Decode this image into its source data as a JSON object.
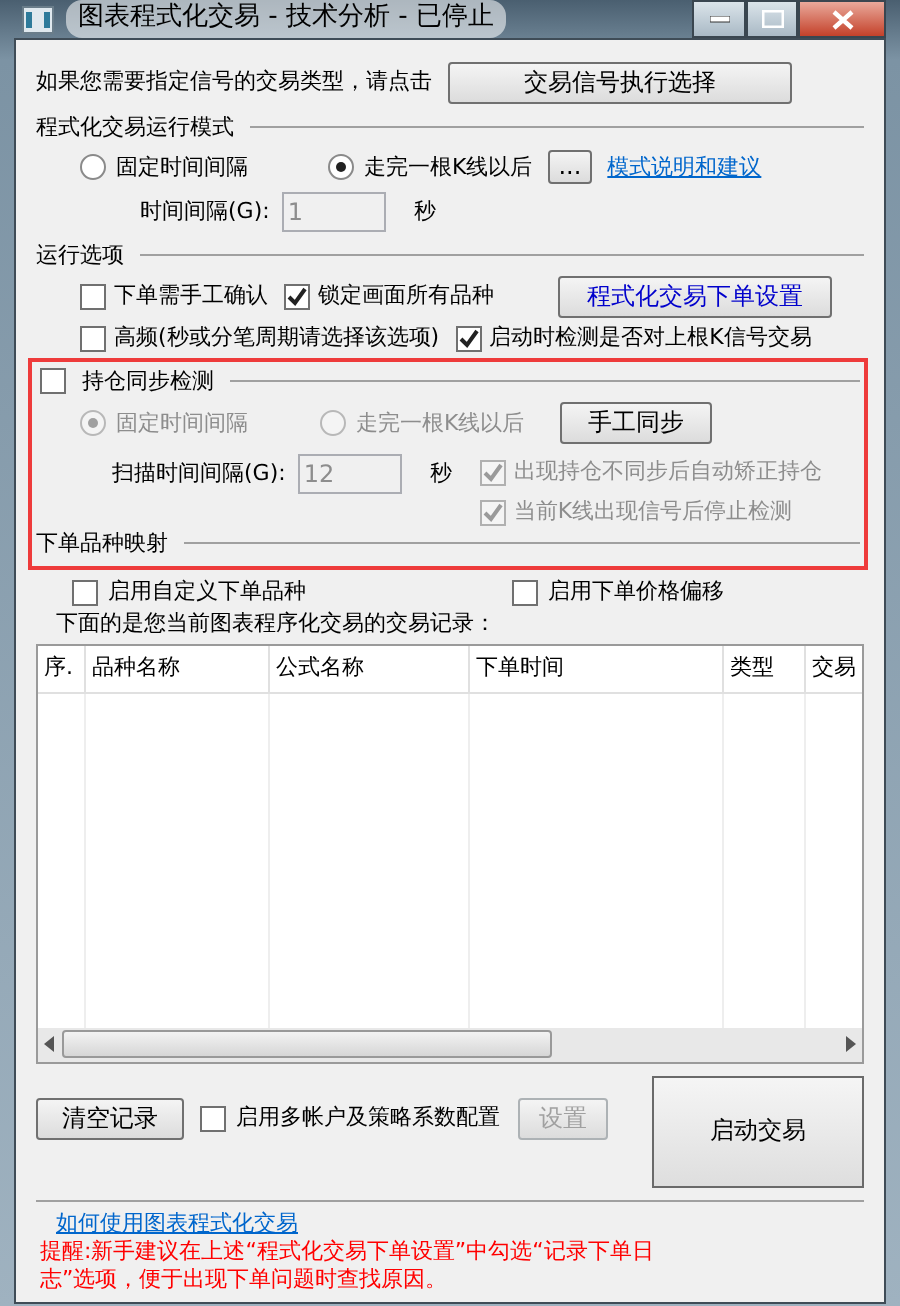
{
  "window": {
    "title": "图表程式化交易 - 技术分析 - 已停止"
  },
  "signal_type": {
    "prompt": "如果您需要指定信号的交易类型，请点击",
    "button": "交易信号执行选择"
  },
  "run_mode": {
    "heading": "程式化交易运行模式",
    "options": [
      {
        "label": "固定时间间隔",
        "selected": false
      },
      {
        "label": "走完一根K线以后",
        "selected": true
      }
    ],
    "more_button": "...",
    "link": "模式说明和建议",
    "interval": {
      "label": "时间间隔(G):",
      "value": "1",
      "unit": "秒",
      "disabled": true
    }
  },
  "run_options": {
    "heading": "运行选项",
    "checkboxes": [
      {
        "label": "下单需手工确认",
        "checked": false
      },
      {
        "label": "锁定画面所有品种",
        "checked": true
      },
      {
        "label": "高频(秒或分笔周期请选择该选项)",
        "checked": false
      },
      {
        "label": "启动时检测是否对上根K信号交易",
        "checked": true
      }
    ],
    "settings_button": "程式化交易下单设置"
  },
  "position_sync": {
    "label": "持仓同步检测",
    "checked": false,
    "options": [
      {
        "label": "固定时间间隔",
        "selected": true,
        "disabled": true
      },
      {
        "label": "走完一根K线以后",
        "selected": false,
        "disabled": true
      }
    ],
    "sync_button": "手工同步",
    "scan": {
      "label": "扫描时间间隔(G):",
      "value": "12",
      "unit": "秒",
      "disabled": true
    },
    "checkboxes": [
      {
        "label": "出现持仓不同步后自动矫正持仓",
        "checked": true,
        "disabled": true
      },
      {
        "label": "当前K线出现信号后停止检测",
        "checked": true,
        "disabled": true
      }
    ]
  },
  "mapping": {
    "heading": "下单品种映射",
    "checkboxes": [
      {
        "label": "启用自定义下单品种",
        "checked": false
      },
      {
        "label": "启用下单价格偏移",
        "checked": false
      }
    ]
  },
  "records": {
    "caption": "下面的是您当前图表程序化交易的交易记录：",
    "columns": [
      "序.",
      "品种名称",
      "公式名称",
      "下单时间",
      "类型",
      "交易"
    ]
  },
  "bottom": {
    "clear_button": "清空记录",
    "multi_account": {
      "label": "启用多帐户及策略系数配置",
      "checked": false
    },
    "settings_button": {
      "label": "设置",
      "disabled": true
    },
    "start_button": "启动交易"
  },
  "help_link": "如何使用图表程式化交易",
  "reminder": "提醒:新手建议在上述“程式化交易下单设置”中勾选“记录下单日志”选项，便于出现下单问题时查找原因。"
}
